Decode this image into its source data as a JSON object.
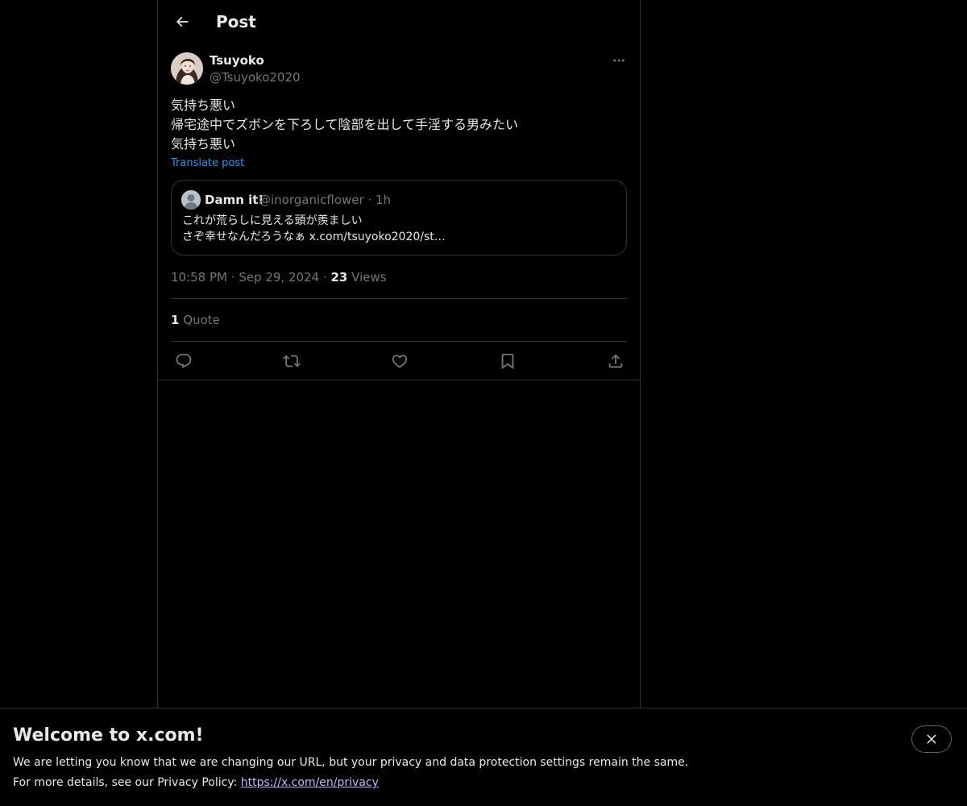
{
  "header": {
    "title": "Post",
    "back_icon": "arrow-left-icon"
  },
  "post": {
    "author_name": "Tsuyoko",
    "author_handle": "@Tsuyoko2020",
    "more_icon": "ellipsis-icon",
    "text_lines": [
      "気持ち悪い",
      "帰宅途中でズボンを下ろして陰部を出して手淫する男みたい",
      "気持ち悪い"
    ],
    "translate_label": "Translate post",
    "quote": {
      "name": "Damn it!",
      "handle_time": "@inorganicflower · 1h",
      "text_lines": [
        "これが荒らしに見える頭が羨ましい",
        "さぞ幸せなんだろうなぁ x.com/tsuyoko2020/st…"
      ]
    },
    "time": "10:58 PM",
    "date": "Sep 29, 2024",
    "views_count": "23",
    "views_label": "Views",
    "quotes_count": "1",
    "quotes_label": "Quote",
    "actions": [
      "reply-icon",
      "repost-icon",
      "like-icon",
      "bookmark-icon",
      "share-icon"
    ]
  },
  "banner": {
    "title": "Welcome to x.com!",
    "line1": "We are letting you know that we are changing our URL, but your privacy and data protection settings remain the same.",
    "line2_prefix": "For more details, see our Privacy Policy: ",
    "link_text": "https://x.com/en/privacy",
    "close_icon": "close-icon"
  },
  "colors": {
    "background": "#000000",
    "text": "#e7e9ea",
    "muted": "#71767b",
    "accent": "#1d9bf0",
    "border": "#2f3336"
  }
}
